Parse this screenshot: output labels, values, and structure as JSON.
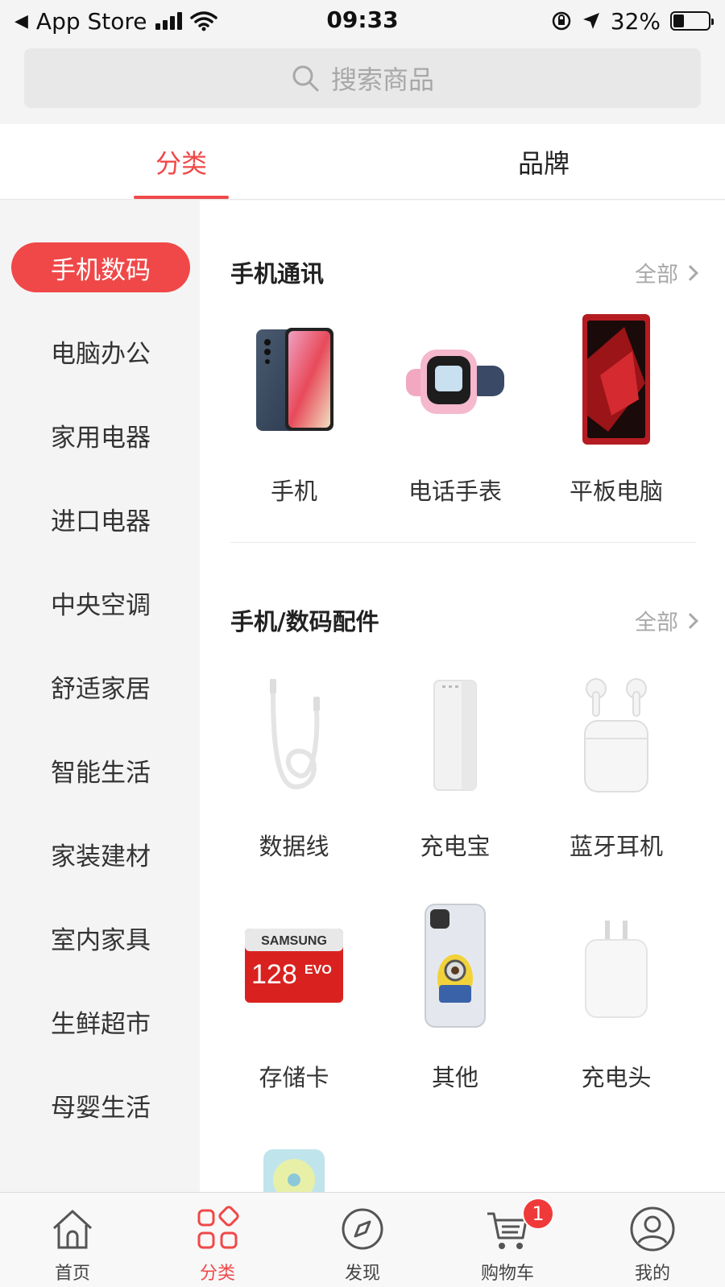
{
  "status_bar": {
    "back_label": "App Store",
    "time": "09:33",
    "battery": "32%",
    "battery_level": 0.32
  },
  "search": {
    "placeholder": "搜索商品"
  },
  "tabs": [
    {
      "label": "分类",
      "active": true
    },
    {
      "label": "品牌",
      "active": false
    }
  ],
  "sidebar": {
    "items": [
      {
        "label": "手机数码",
        "active": true
      },
      {
        "label": "电脑办公"
      },
      {
        "label": "家用电器"
      },
      {
        "label": "进口电器"
      },
      {
        "label": "中央空调"
      },
      {
        "label": "舒适家居"
      },
      {
        "label": "智能生活"
      },
      {
        "label": "家装建材"
      },
      {
        "label": "室内家具"
      },
      {
        "label": "生鲜超市"
      },
      {
        "label": "母婴生活"
      }
    ]
  },
  "sections": [
    {
      "title": "手机通讯",
      "all_label": "全部",
      "products": [
        {
          "name": "手机",
          "icon": "phone-image"
        },
        {
          "name": "电话手表",
          "icon": "smartwatch-image"
        },
        {
          "name": "平板电脑",
          "icon": "tablet-image"
        }
      ]
    },
    {
      "title": "手机/数码配件",
      "all_label": "全部",
      "products": [
        {
          "name": "数据线",
          "icon": "cable-image"
        },
        {
          "name": "充电宝",
          "icon": "power-bank-image"
        },
        {
          "name": "蓝牙耳机",
          "icon": "earbuds-image"
        },
        {
          "name": "存储卡",
          "icon": "memory-card-image"
        },
        {
          "name": "其他",
          "icon": "phone-case-image"
        },
        {
          "name": "充电头",
          "icon": "charger-image"
        }
      ],
      "memory_card_text": {
        "brand": "SAMSUNG",
        "capacity": "128",
        "series": "EVO"
      }
    }
  ],
  "tabbar": {
    "items": [
      {
        "label": "首页",
        "icon": "home-icon"
      },
      {
        "label": "分类",
        "icon": "category-icon",
        "active": true
      },
      {
        "label": "发现",
        "icon": "compass-icon"
      },
      {
        "label": "购物车",
        "icon": "cart-icon",
        "badge": "1"
      },
      {
        "label": "我的",
        "icon": "profile-icon"
      }
    ]
  },
  "colors": {
    "accent": "#f04848",
    "background": "#f4f4f4"
  }
}
